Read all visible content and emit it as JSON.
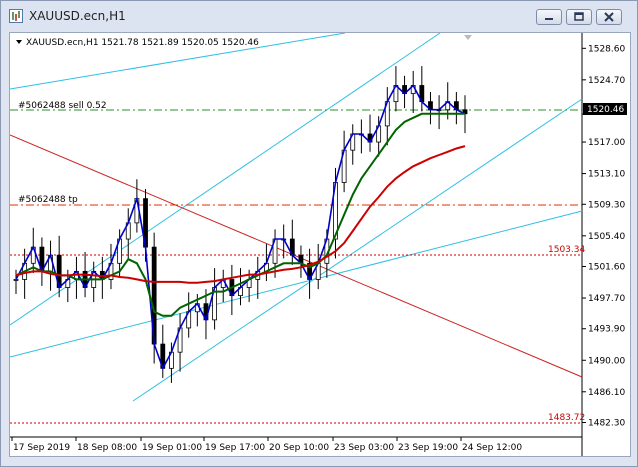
{
  "window": {
    "title": "XAUUSD.ecn,H1",
    "minimize_icon": "minimize-icon",
    "restore_icon": "restore-icon",
    "close_icon": "close-icon"
  },
  "chart_info": {
    "symbol_line": "XAUUSD.ecn,H1  1521.78 1521.89 1520.05 1520.46"
  },
  "orders": {
    "sell_label": "#5062488 sell 0.52",
    "sell_price": 1520.46,
    "tp_label": "#5062488 tp",
    "tp_price": 1509.5,
    "level_high": "1503.34",
    "level_low": "1483.72"
  },
  "colors": {
    "bull_bear_candle": "#000000",
    "ma_fast": "#0000cc",
    "ma_mid": "#006400",
    "ma_slow": "#cc0000",
    "trend_channel": "#2ec0e0",
    "trend_line_red": "#cc2222",
    "sell_line": "#2e8b2e",
    "tp_line": "#dd3300",
    "level_line": "#cc0000",
    "current_price_box": "#000000"
  },
  "chart_data": {
    "type": "line",
    "title": "XAUUSD.ecn,H1",
    "xlabel": "",
    "ylabel": "",
    "ylim": [
      1481.0,
      1530.0
    ],
    "y_ticks": [
      "1528.60",
      "1524.70",
      "1520.46",
      "1517.00",
      "1513.10",
      "1509.30",
      "1505.40",
      "1501.60",
      "1497.70",
      "1493.90",
      "1490.00",
      "1486.10",
      "1482.30"
    ],
    "x_ticks": [
      "17 Sep 2019",
      "18 Sep 08:00",
      "19 Sep 01:00",
      "19 Sep 17:00",
      "20 Sep 10:00",
      "23 Sep 03:00",
      "23 Sep 19:00",
      "24 Sep 12:00"
    ],
    "series": [
      {
        "values": [
          1500,
          1502,
          1504,
          1501,
          1503,
          1499,
          1500,
          1501,
          1499,
          1501,
          1500,
          1502,
          1505,
          1507,
          1510,
          1504,
          1492,
          1489,
          1491,
          1494,
          1496,
          1497,
          1495,
          1499,
          1500,
          1498,
          1499,
          1500,
          1501,
          1502,
          1505,
          1505,
          1503,
          1502,
          1500,
          1502,
          1505,
          1512,
          1516,
          1518,
          1518,
          1517,
          1519,
          1522,
          1524,
          1523,
          1524,
          1522,
          1521,
          1521,
          1522,
          1521,
          1520.5
        ]
      },
      {
        "values": [
          1500.5,
          1501,
          1501.5,
          1501,
          1501,
          1500.5,
          1500.5,
          1500,
          1500,
          1500,
          1500,
          1500.5,
          1501,
          1502.5,
          1502,
          1500,
          1496,
          1495.5,
          1495.5,
          1496.5,
          1497,
          1497.5,
          1498,
          1498.5,
          1498.5,
          1499,
          1499.5,
          1500,
          1500.5,
          1501,
          1501.5,
          1502,
          1502,
          1502,
          1501.5,
          1502,
          1503,
          1505.5,
          1508,
          1510.5,
          1512.5,
          1514,
          1515.5,
          1517,
          1518.5,
          1519.5,
          1520,
          1520.5,
          1520.5,
          1520.5,
          1520.5,
          1520.5,
          1520.5
        ]
      },
      {
        "values": [
          1500.5,
          1500.8,
          1501,
          1501,
          1500.7,
          1500.5,
          1500.5,
          1500.6,
          1500.6,
          1500.5,
          1500.4,
          1500.5,
          1500.3,
          1500.2,
          1500,
          1499.8,
          1499.7,
          1499.7,
          1499.7,
          1499.7,
          1499.6,
          1499.6,
          1499.7,
          1499.8,
          1500,
          1500.2,
          1500.4,
          1500.6,
          1500.6,
          1500.8,
          1501,
          1501.2,
          1501.3,
          1501.5,
          1501.8,
          1502.2,
          1502.8,
          1503.5,
          1504.5,
          1506,
          1507.5,
          1509,
          1510.2,
          1511.5,
          1512.5,
          1513.3,
          1514,
          1514.5,
          1515,
          1515.4,
          1515.8,
          1516.2,
          1516.5
        ]
      }
    ]
  }
}
